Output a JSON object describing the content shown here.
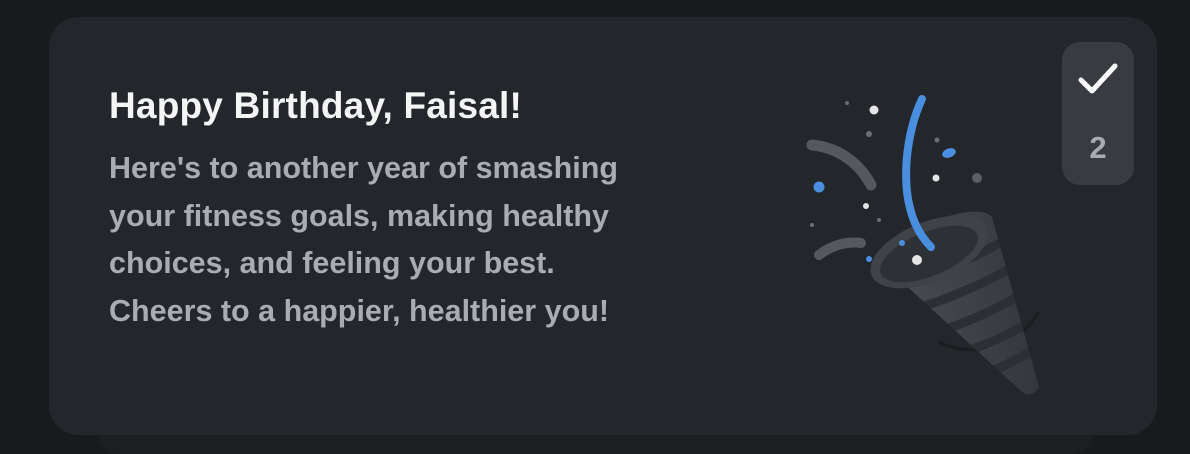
{
  "card": {
    "title": "Happy Birthday, Faisal!",
    "message": "Here's to another year of smashing your fitness goals, making healthy choices, and feeling your best. Cheers to a happier, healthier you!"
  },
  "badge": {
    "count": "2",
    "icon": "checkmark-icon"
  },
  "illustration": {
    "icon": "party-popper-icon"
  },
  "colors": {
    "background": "#181b1e",
    "card": "#23262a",
    "badge": "#383b40",
    "title": "#f5f5f5",
    "message": "#a9acb0",
    "accent_blue": "#4a90e2"
  }
}
